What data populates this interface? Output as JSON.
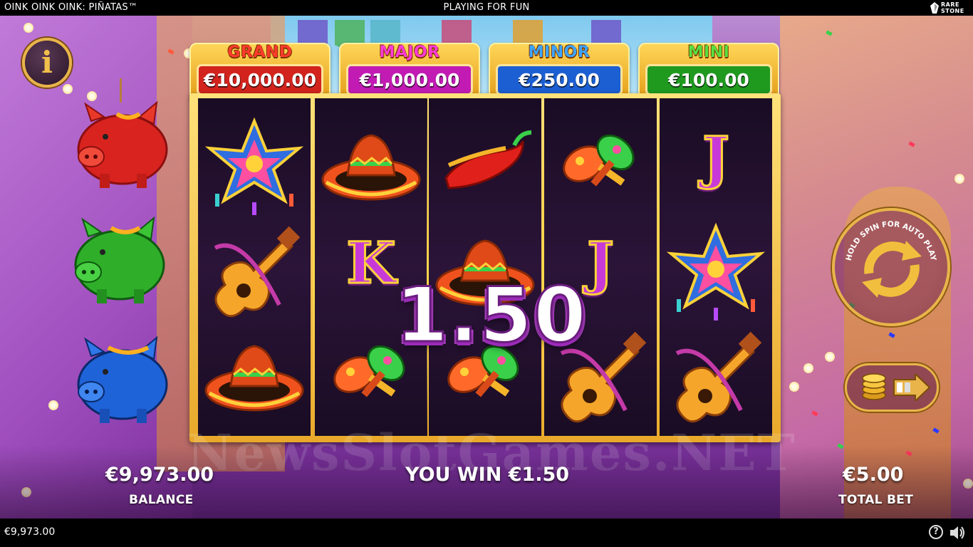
{
  "top_bar": {
    "game_title": "OINK OINK OINK: PIÑATAS™",
    "mode": "PLAYING FOR FUN",
    "brand_line1": "RARE",
    "brand_line2": "STONE"
  },
  "jackpots": [
    {
      "name": "GRAND",
      "value": "€10,000.00",
      "name_color": "#ff3b2c",
      "box_color": "#d2231d"
    },
    {
      "name": "MAJOR",
      "value": "€1,000.00",
      "name_color": "#ff3bd6",
      "box_color": "#c21bb4"
    },
    {
      "name": "MINOR",
      "value": "€250.00",
      "name_color": "#3ea5ff",
      "box_color": "#1c5fd2"
    },
    {
      "name": "MINI",
      "value": "€100.00",
      "name_color": "#58e040",
      "box_color": "#1f9a1f"
    }
  ],
  "reels": [
    [
      "star-pinata",
      "guitar",
      "sombrero"
    ],
    [
      "sombrero",
      "letter-k",
      "maracas"
    ],
    [
      "chili-pepper",
      "sombrero",
      "maracas"
    ],
    [
      "maracas",
      "letter-j",
      "guitar"
    ],
    [
      "letter-j",
      "star-pinata",
      "guitar"
    ]
  ],
  "symbol_letters": {
    "letter-k": "K",
    "letter-j": "J"
  },
  "win_amount": "1.50",
  "bottom": {
    "balance_value": "€9,973.00",
    "balance_label": "BALANCE",
    "win_message": "YOU WIN €1.50",
    "total_bet_value": "€5.00",
    "total_bet_label": "TOTAL BET"
  },
  "spin_button_text": "HOLD SPIN FOR AUTO PLAY",
  "info_button_label": "i",
  "watermark": "NewsSlotGames.NET",
  "footer": {
    "balance": "€9,973.00",
    "help_label": "?"
  },
  "pigs": [
    {
      "color": "red",
      "fill": "#d9231f"
    },
    {
      "color": "green",
      "fill": "#2fae2a"
    },
    {
      "color": "blue",
      "fill": "#1f63d8"
    }
  ],
  "icons": [
    "info-icon",
    "spin-arrows-icon",
    "coin-stack-icon",
    "arrow-right-icon",
    "help-icon",
    "speaker-icon",
    "rarestone-logo-icon"
  ]
}
